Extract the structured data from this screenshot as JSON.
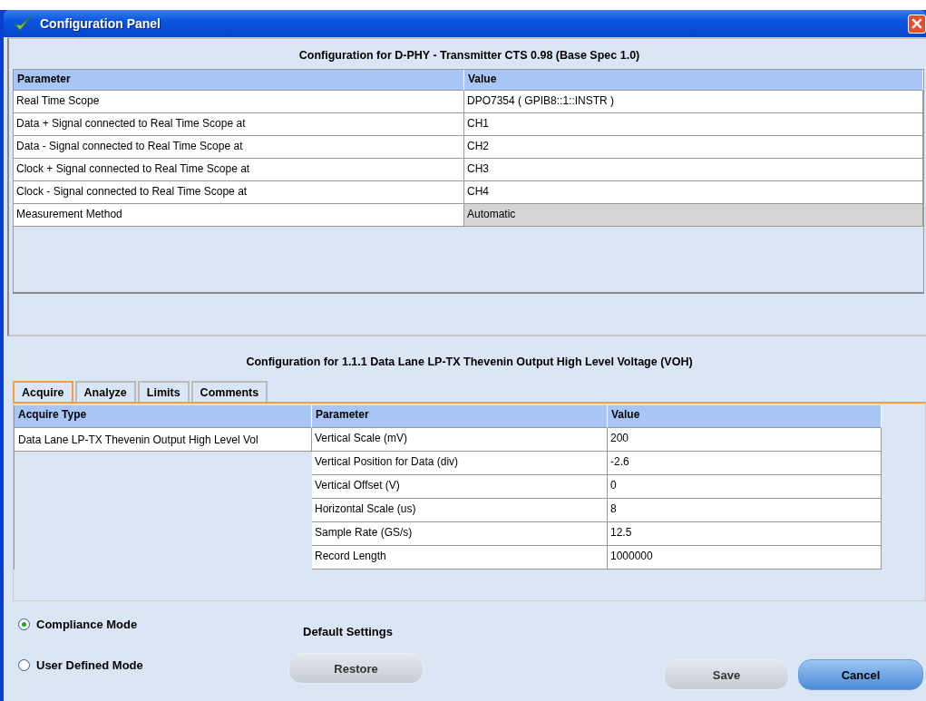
{
  "window": {
    "title": "Configuration Panel"
  },
  "top_heading": "Configuration for D-PHY - Transmitter CTS 0.98 (Base Spec 1.0)",
  "top_table": {
    "columns": [
      "Parameter",
      "Value"
    ],
    "rows": [
      {
        "parameter": "Real Time Scope",
        "value": "DPO7354 ( GPIB8::1::INSTR )",
        "disabled": false
      },
      {
        "parameter": "Data + Signal connected to Real Time Scope at",
        "value": "CH1",
        "disabled": false
      },
      {
        "parameter": "Data - Signal connected to Real Time Scope at",
        "value": "CH2",
        "disabled": false
      },
      {
        "parameter": "Clock + Signal connected to Real Time Scope at",
        "value": "CH3",
        "disabled": false
      },
      {
        "parameter": "Clock - Signal connected to Real Time Scope at",
        "value": "CH4",
        "disabled": false
      },
      {
        "parameter": "Measurement Method",
        "value": "Automatic",
        "disabled": true
      }
    ]
  },
  "bottom_heading": "Configuration for 1.1.1 Data Lane LP-TX Thevenin Output High Level Voltage (VOH)",
  "tabs": [
    {
      "label": "Acquire",
      "selected": true
    },
    {
      "label": "Analyze",
      "selected": false
    },
    {
      "label": "Limits",
      "selected": false
    },
    {
      "label": "Comments",
      "selected": false
    }
  ],
  "acquire_table": {
    "columns": [
      "Acquire Type",
      "Parameter",
      "Value"
    ],
    "acquire_type": "Data Lane LP-TX Thevenin Output High Level Vol",
    "rows": [
      {
        "parameter": "Vertical Scale (mV)",
        "value": "200"
      },
      {
        "parameter": "Vertical Position for Data (div)",
        "value": "-2.6"
      },
      {
        "parameter": "Vertical Offset (V)",
        "value": "0"
      },
      {
        "parameter": "Horizontal Scale (us)",
        "value": "8"
      },
      {
        "parameter": "Sample Rate (GS/s)",
        "value": "12.5"
      },
      {
        "parameter": "Record Length",
        "value": "1000000"
      }
    ]
  },
  "modes": [
    {
      "label": "Compliance Mode",
      "selected": true
    },
    {
      "label": "User Defined Mode",
      "selected": false
    }
  ],
  "default_settings": {
    "label": "Default Settings",
    "button": "Restore"
  },
  "buttons": [
    {
      "label": "Save",
      "kind": "plain"
    },
    {
      "label": "Cancel",
      "kind": "primary"
    }
  ]
}
